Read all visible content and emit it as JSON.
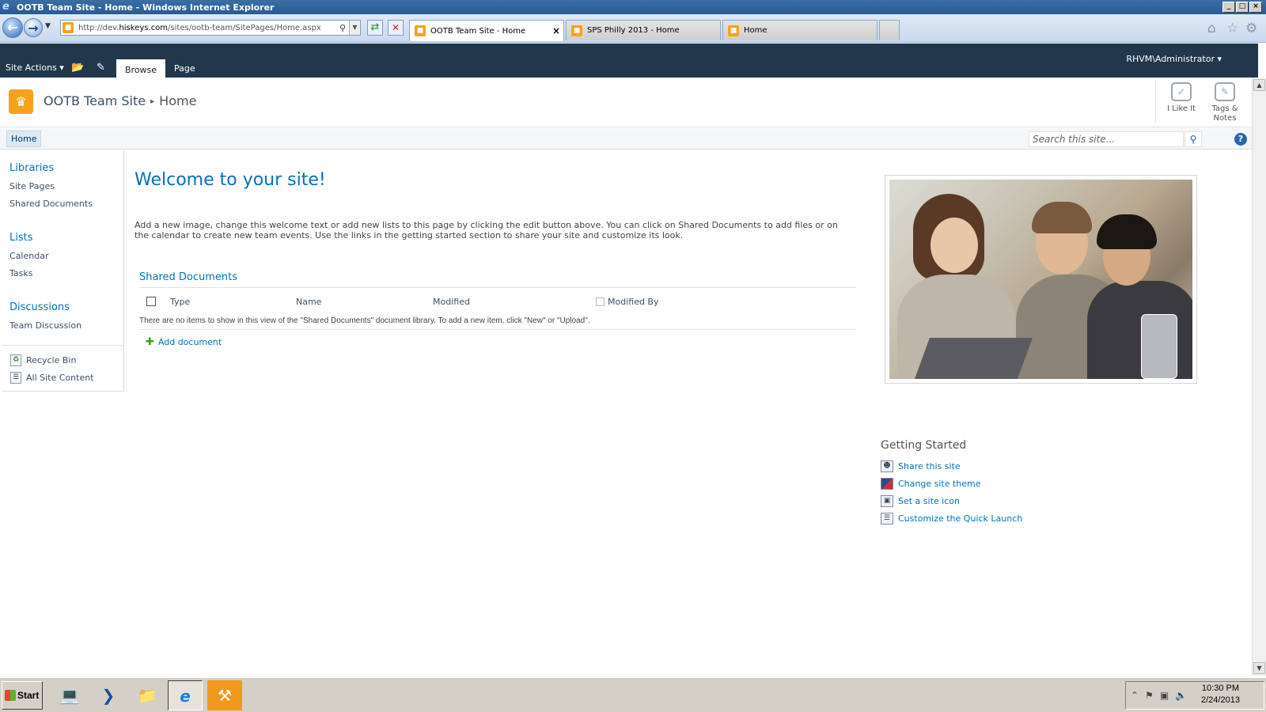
{
  "window": {
    "title": "OOTB Team Site - Home - Windows Internet Explorer",
    "min_label": "_",
    "max_label": "□",
    "close_label": "×"
  },
  "browser": {
    "url_prefix": "http://dev.",
    "url_host": "hiskeys.com",
    "url_path": "/sites/ootb-team/SitePages/Home.aspx",
    "tabs": [
      {
        "label": "OOTB Team Site - Home",
        "close": "×"
      },
      {
        "label": "SPS Philly 2013 - Home"
      },
      {
        "label": "Home"
      }
    ]
  },
  "ribbon": {
    "site_actions": "Site Actions ▾",
    "tabs": [
      "Browse",
      "Page"
    ],
    "user": "RHVM\\Administrator ▾"
  },
  "header": {
    "site_title": "OOTB Team Site",
    "separator": "▸",
    "current_page": "Home",
    "social": [
      {
        "label": "I Like It"
      },
      {
        "label": "Tags & Notes"
      }
    ]
  },
  "topnav": {
    "home": "Home",
    "search_placeholder": "Search this site...",
    "help": "?"
  },
  "quick_launch": {
    "libraries": {
      "heading": "Libraries",
      "items": [
        "Site Pages",
        "Shared Documents"
      ]
    },
    "lists": {
      "heading": "Lists",
      "items": [
        "Calendar",
        "Tasks"
      ]
    },
    "discussions": {
      "heading": "Discussions",
      "items": [
        "Team Discussion"
      ]
    },
    "bottom": [
      "Recycle Bin",
      "All Site Content"
    ]
  },
  "main": {
    "welcome": "Welcome to your site!",
    "intro": "Add a new image, change this welcome text or add new lists to this page by clicking the edit button above. You can click on Shared Documents to add files or on the calendar to create new team events. Use the links in the getting started section to share your site and customize its look.",
    "library_title": "Shared Documents",
    "columns": [
      "Type",
      "Name",
      "Modified",
      "Modified By"
    ],
    "empty_message": "There are no items to show in this view of the \"Shared Documents\" document library. To add a new item, click \"New\" or \"Upload\".",
    "add_document": "Add document"
  },
  "getting_started": {
    "title": "Getting Started",
    "items": [
      "Share this site",
      "Change site theme",
      "Set a site icon",
      "Customize the Quick Launch"
    ]
  },
  "taskbar": {
    "start": "Start",
    "time": "10:30 PM",
    "date": "2/24/2013"
  }
}
